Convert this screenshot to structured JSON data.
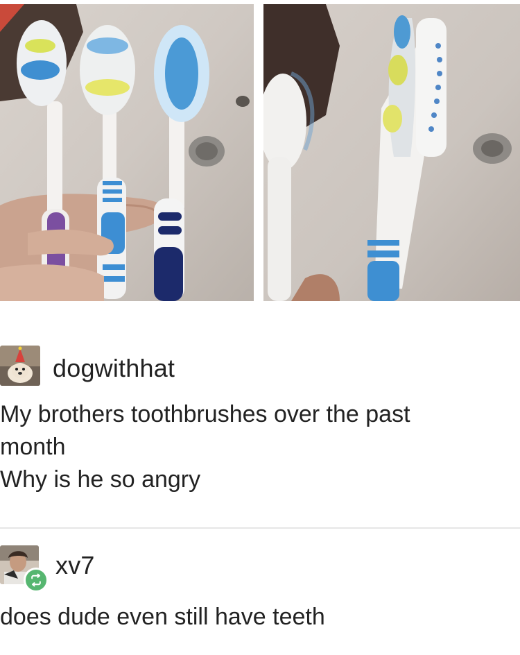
{
  "post": {
    "username": "dogwithhat",
    "lines": [
      "My brothers toothbrushes over the past",
      "month",
      "Why is he so angry"
    ]
  },
  "reply": {
    "username": "xv7",
    "text": "does dude even still have teeth"
  },
  "icons": {
    "reblog": "reblog-icon"
  },
  "colors": {
    "reblog_badge": "#56b670",
    "divider": "#e6e6e6"
  }
}
